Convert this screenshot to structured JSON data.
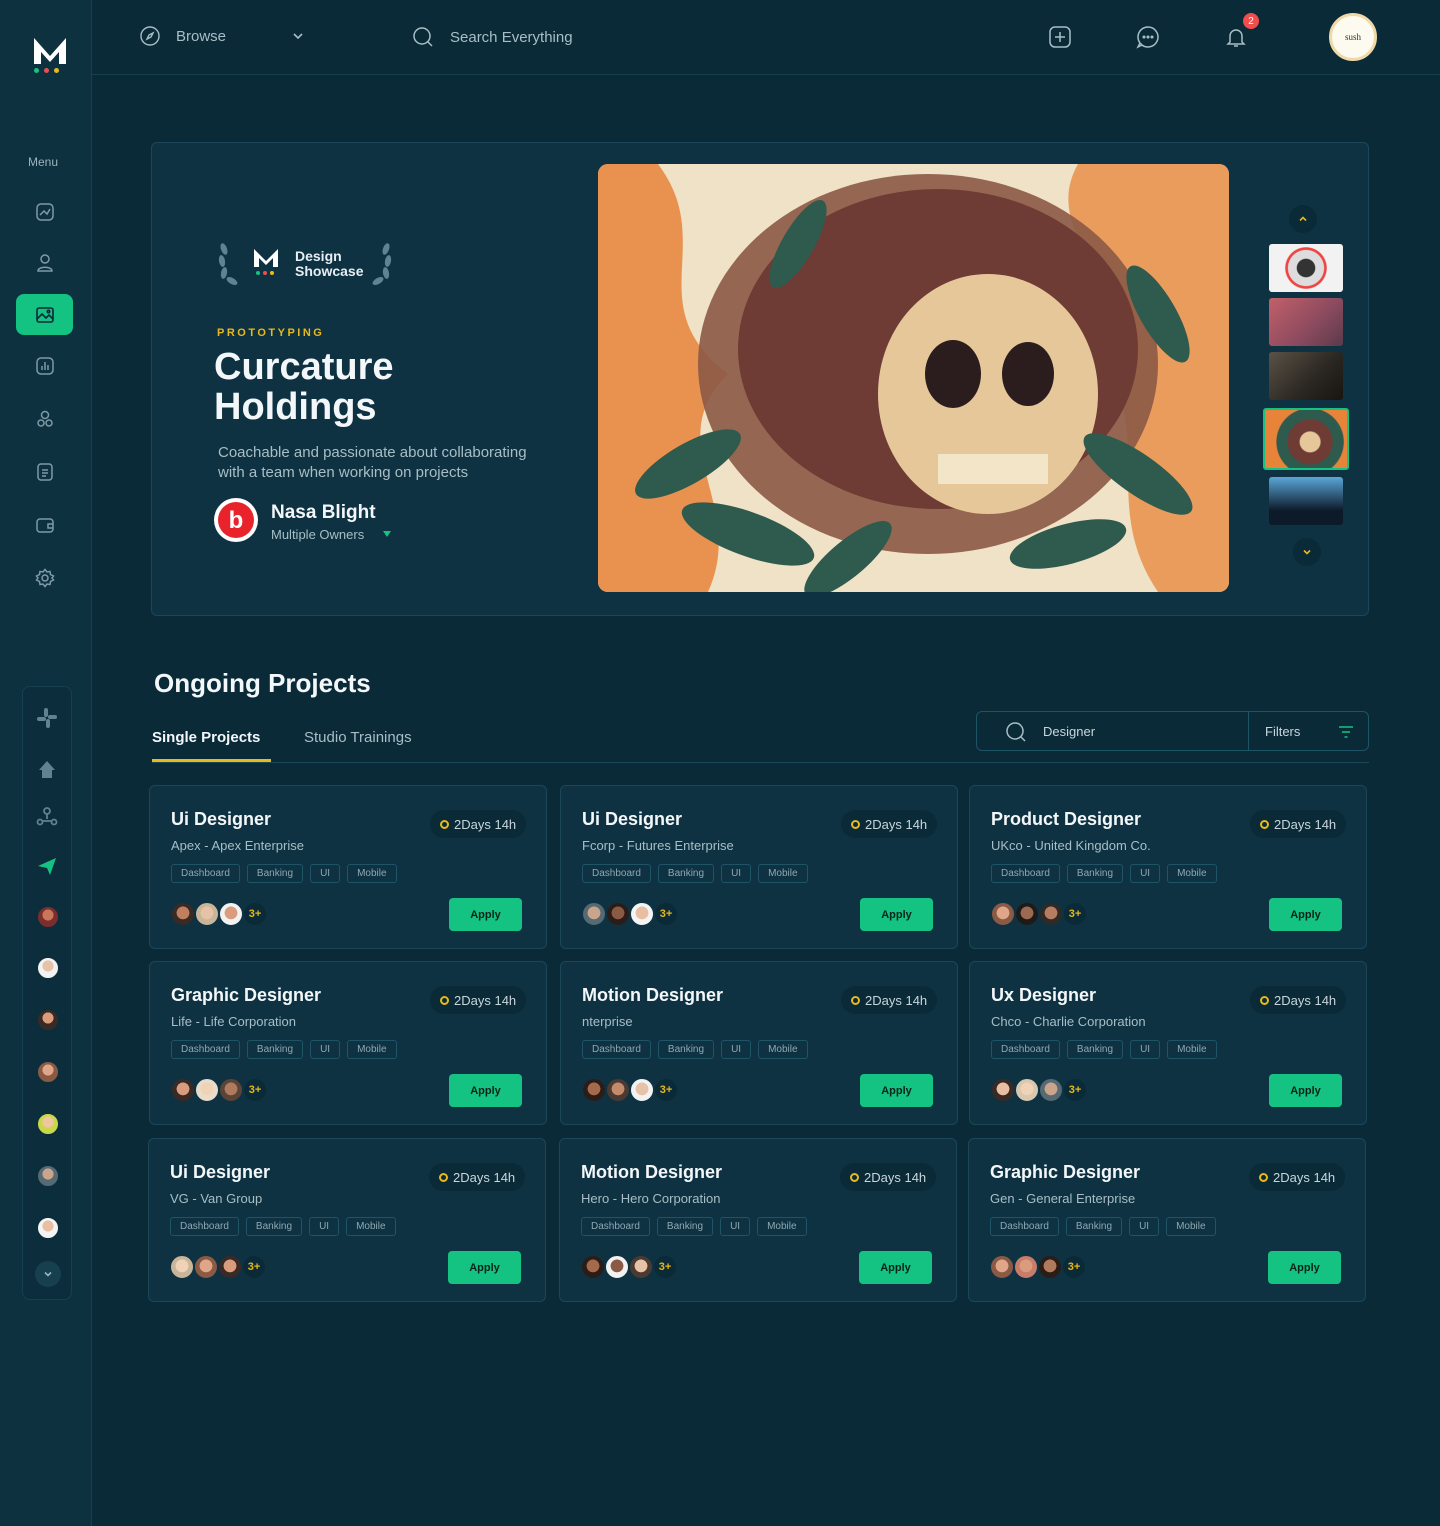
{
  "sidebar": {
    "menu_label": "Menu",
    "colors": {
      "accent": "#14c281",
      "dot_green": "#14c281",
      "dot_red": "#f04d4d",
      "dot_yellow": "#e8b91a"
    }
  },
  "topbar": {
    "browse_label": "Browse",
    "search_placeholder": "Search Everything",
    "notification_count": "2",
    "avatar_text": "sush"
  },
  "hero": {
    "award_line1": "Design",
    "award_line2": "Showcase",
    "category": "PROTOTYPING",
    "title": "Curcature Holdings",
    "description": "Coachable and passionate about collaborating with a team when working on projects",
    "owner_name": "Nasa Blight",
    "owner_sub": "Multiple Owners",
    "owner_logo_letter": "b"
  },
  "projects": {
    "title": "Ongoing Projects",
    "tabs": [
      "Single Projects",
      "Studio Trainings"
    ],
    "search_value": "Designer",
    "filters_label": "Filters",
    "cards": [
      {
        "title": "Ui Designer",
        "company": "Apex - Apex Enterprise",
        "timer": "2Days 14h",
        "tags": [
          "Dashboard",
          "Banking",
          "UI",
          "Mobile"
        ],
        "more": "3+",
        "apply": "Apply"
      },
      {
        "title": "Ui Designer",
        "company": "Fcorp - Futures Enterprise",
        "timer": "2Days 14h",
        "tags": [
          "Dashboard",
          "Banking",
          "UI",
          "Mobile"
        ],
        "more": "3+",
        "apply": "Apply"
      },
      {
        "title": "Product Designer",
        "company": "UKco - United Kingdom Co.",
        "timer": "2Days 14h",
        "tags": [
          "Dashboard",
          "Banking",
          "UI",
          "Mobile"
        ],
        "more": "3+",
        "apply": "Apply"
      },
      {
        "title": "Graphic Designer",
        "company": "Life - Life Corporation",
        "timer": "2Days 14h",
        "tags": [
          "Dashboard",
          "Banking",
          "UI",
          "Mobile"
        ],
        "more": "3+",
        "apply": "Apply"
      },
      {
        "title": "Motion Designer",
        "company": "nterprise",
        "timer": "2Days 14h",
        "tags": [
          "Dashboard",
          "Banking",
          "UI",
          "Mobile"
        ],
        "more": "3+",
        "apply": "Apply"
      },
      {
        "title": "Ux Designer",
        "company": "Chco - Charlie Corporation",
        "timer": "2Days 14h",
        "tags": [
          "Dashboard",
          "Banking",
          "UI",
          "Mobile"
        ],
        "more": "3+",
        "apply": "Apply"
      },
      {
        "title": "Ui Designer",
        "company": "VG - Van Group",
        "timer": "2Days 14h",
        "tags": [
          "Dashboard",
          "Banking",
          "UI",
          "Mobile"
        ],
        "more": "3+",
        "apply": "Apply"
      },
      {
        "title": "Motion Designer",
        "company": "Hero - Hero Corporation",
        "timer": "2Days 14h",
        "tags": [
          "Dashboard",
          "Banking",
          "UI",
          "Mobile"
        ],
        "more": "3+",
        "apply": "Apply"
      },
      {
        "title": "Graphic Designer",
        "company": "Gen - General Enterprise",
        "timer": "2Days 14h",
        "tags": [
          "Dashboard",
          "Banking",
          "UI",
          "Mobile"
        ],
        "more": "3+",
        "apply": "Apply"
      }
    ]
  }
}
